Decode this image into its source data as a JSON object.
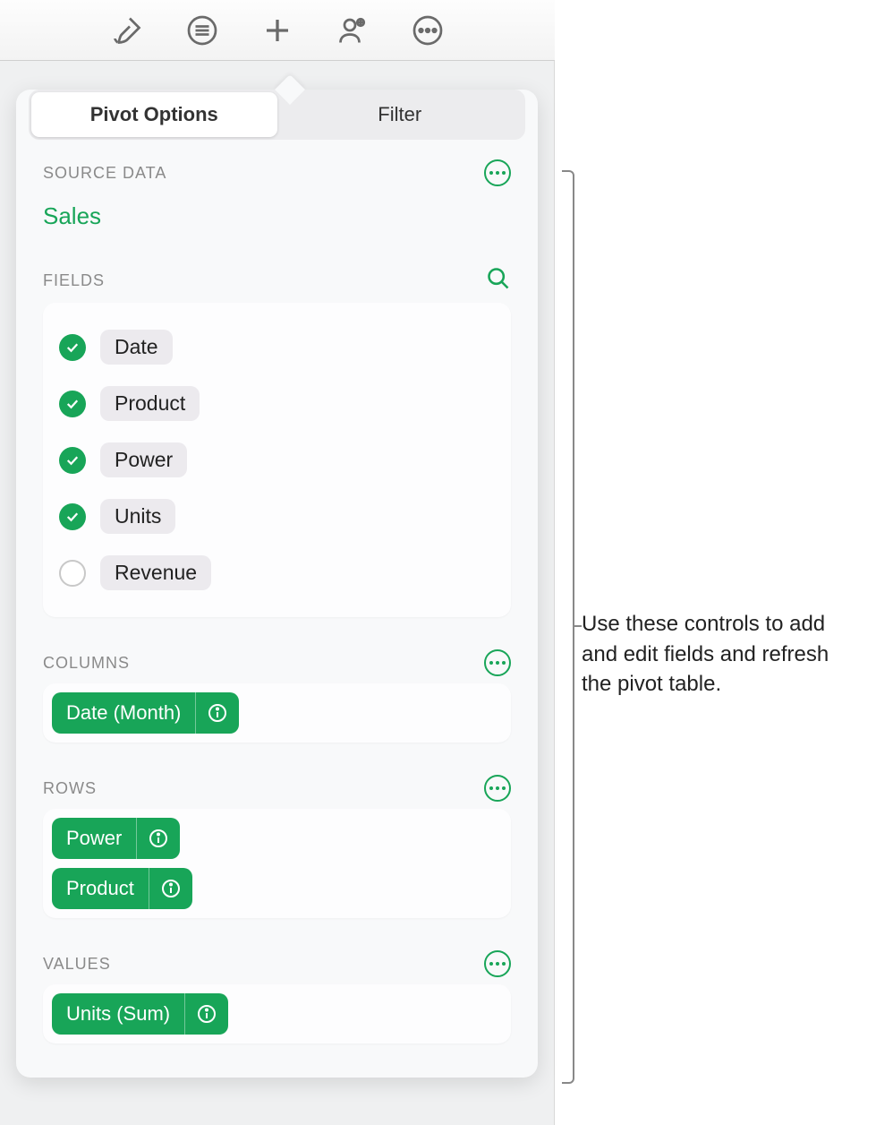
{
  "toolbar_icons": [
    "format-brush-icon",
    "list-icon",
    "add-icon",
    "collaborate-icon",
    "more-icon"
  ],
  "tabs": {
    "pivot": "Pivot Options",
    "filter": "Filter"
  },
  "source": {
    "label": "SOURCE DATA",
    "name": "Sales"
  },
  "fields": {
    "label": "FIELDS",
    "items": [
      {
        "name": "Date",
        "checked": true
      },
      {
        "name": "Product",
        "checked": true
      },
      {
        "name": "Power",
        "checked": true
      },
      {
        "name": "Units",
        "checked": true
      },
      {
        "name": "Revenue",
        "checked": false
      }
    ]
  },
  "columns": {
    "label": "COLUMNS",
    "chips": [
      "Date (Month)"
    ]
  },
  "rows": {
    "label": "ROWS",
    "chips": [
      "Power",
      "Product"
    ]
  },
  "values": {
    "label": "VALUES",
    "chips": [
      "Units (Sum)"
    ]
  },
  "callout": "Use these controls to add and edit fields and refresh the pivot table."
}
